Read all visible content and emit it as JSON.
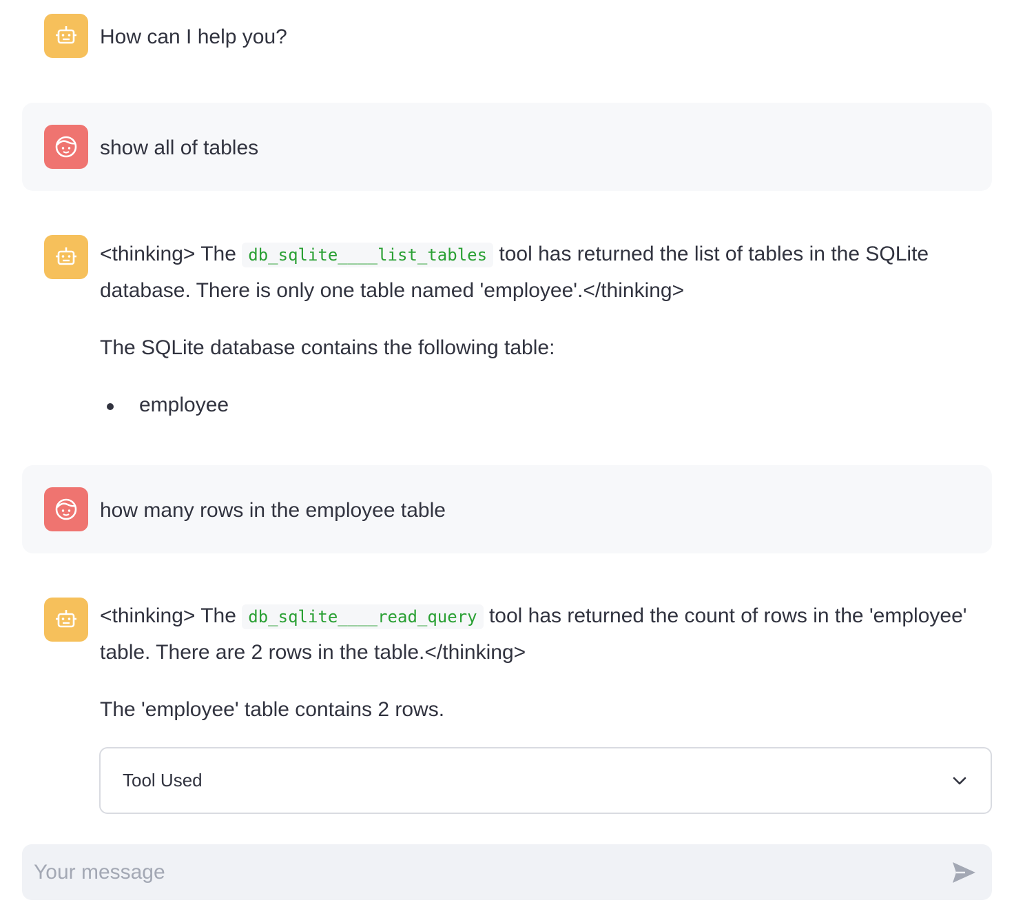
{
  "colors": {
    "bot_avatar": "#f6c05b",
    "user_avatar": "#ef7470",
    "code_text": "#2aa034",
    "user_message_bg": "#f7f8fa"
  },
  "messages": [
    {
      "role": "assistant",
      "avatar_icon": "bot-icon",
      "text": "How can I help you?"
    },
    {
      "role": "user",
      "avatar_icon": "user-face-icon",
      "text": "show all of tables"
    },
    {
      "role": "assistant",
      "avatar_icon": "bot-icon",
      "thinking_prefix": "<thinking> The ",
      "code": "db_sqlite____list_tables",
      "thinking_suffix": " tool has returned the list of tables in the SQLite database. There is only one table named 'employee'.</thinking>",
      "paragraph": "The SQLite database contains the following table:",
      "list": [
        "employee"
      ]
    },
    {
      "role": "user",
      "avatar_icon": "user-face-icon",
      "text": "how many rows in the employee table"
    },
    {
      "role": "assistant",
      "avatar_icon": "bot-icon",
      "thinking_prefix": "<thinking> The ",
      "code": "db_sqlite____read_query",
      "thinking_suffix": " tool has returned the count of rows in the 'employee' table. There are 2 rows in the table.</thinking>",
      "paragraph": "The 'employee' table contains 2 rows.",
      "expander_label": "Tool Used"
    }
  ],
  "chat_input": {
    "placeholder": "Your message",
    "value": ""
  }
}
